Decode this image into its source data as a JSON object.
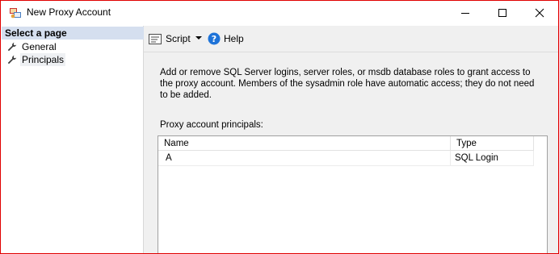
{
  "window": {
    "title": "New Proxy Account",
    "icon": "proxy-account-icon",
    "border_color": "#e00000"
  },
  "sidebar": {
    "header": "Select a page",
    "header_bg": "#d5dfef",
    "items": [
      {
        "label": "General",
        "icon": "wrench-icon"
      },
      {
        "label": "Principals",
        "icon": "wrench-icon",
        "selected": true
      }
    ]
  },
  "toolbar": {
    "script_label": "Script",
    "help_label": "Help"
  },
  "main": {
    "description": "Add or remove SQL Server logins, server roles, or msdb database roles to grant access to the proxy account. Members of the sysadmin role have automatic access; they do not need to be added.",
    "principals_label": "Proxy account principals:",
    "table": {
      "columns": [
        "Name",
        "Type"
      ],
      "rows": [
        {
          "name": "A",
          "type": "SQL Login"
        }
      ]
    }
  }
}
